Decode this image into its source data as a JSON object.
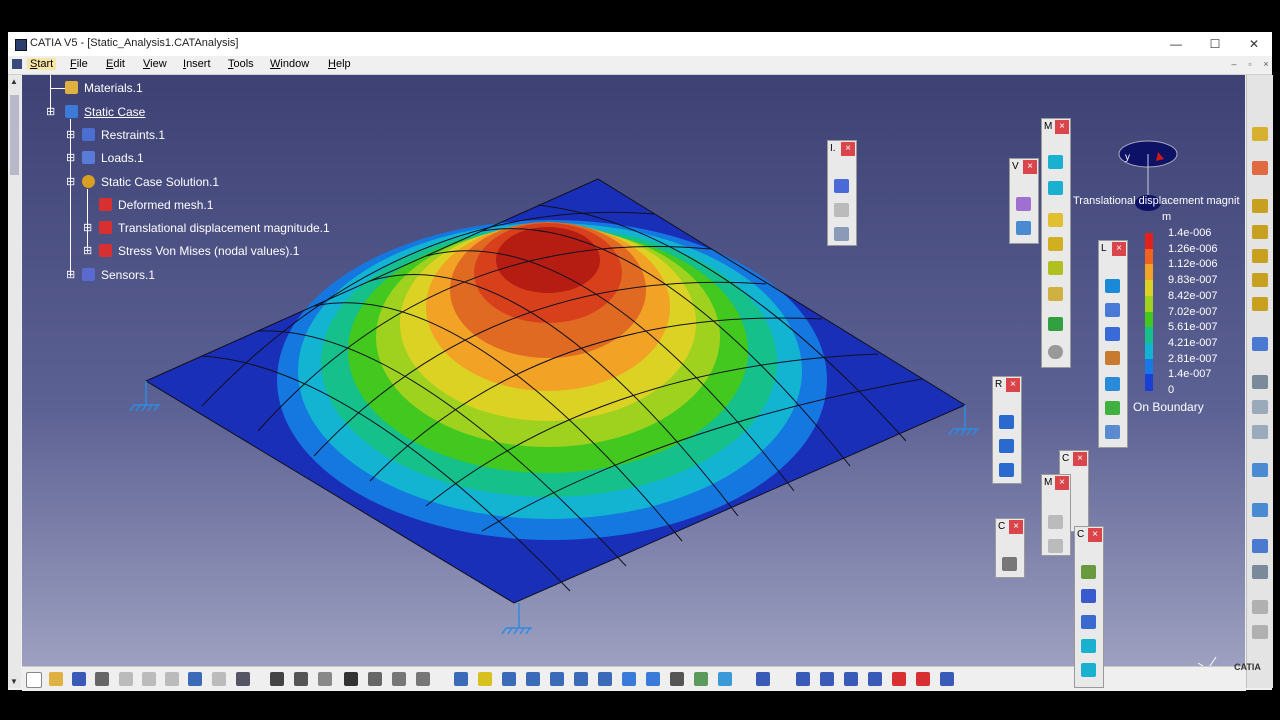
{
  "window": {
    "title": "CATIA V5 - [Static_Analysis1.CATAnalysis]",
    "minimize": "—",
    "maximize": "☐",
    "close": "✕"
  },
  "menu": [
    "Start",
    "File",
    "Edit",
    "View",
    "Insert",
    "Tools",
    "Window",
    "Help"
  ],
  "tree": {
    "materials": "Materials.1",
    "static_case": "Static Case",
    "restraints": "Restraints.1",
    "loads": "Loads.1",
    "solution": "Static Case Solution.1",
    "deformed_mesh": "Deformed mesh.1",
    "translational": "Translational displacement magnitude.1",
    "stress": "Stress Von Mises (nodal values).1",
    "sensors": "Sensors.1"
  },
  "legend": {
    "title": "Translational displacement magnitude",
    "unit": "m",
    "values": [
      "1.4e-006",
      "1.26e-006",
      "1.12e-006",
      "9.83e-007",
      "8.42e-007",
      "7.02e-007",
      "5.61e-007",
      "4.21e-007",
      "2.81e-007",
      "1.4e-007",
      "0"
    ],
    "colors": [
      "#e2221a",
      "#f0621e",
      "#f2a326",
      "#dcd224",
      "#9ed21e",
      "#42c81e",
      "#16c08a",
      "#12b4d2",
      "#1878e4",
      "#1a3fd4"
    ],
    "note": "On Boundary"
  },
  "palettes": [
    "I.",
    "V",
    "M",
    "L",
    "R",
    "C",
    "M",
    "C",
    "C"
  ],
  "compass": {
    "axis": "y"
  },
  "brand": "CATIA",
  "colors": {
    "viewport_top": "#3d4173",
    "viewport_bottom": "#a3a6c4",
    "plate": "#1a2fb8",
    "accent": "#d9454a"
  }
}
